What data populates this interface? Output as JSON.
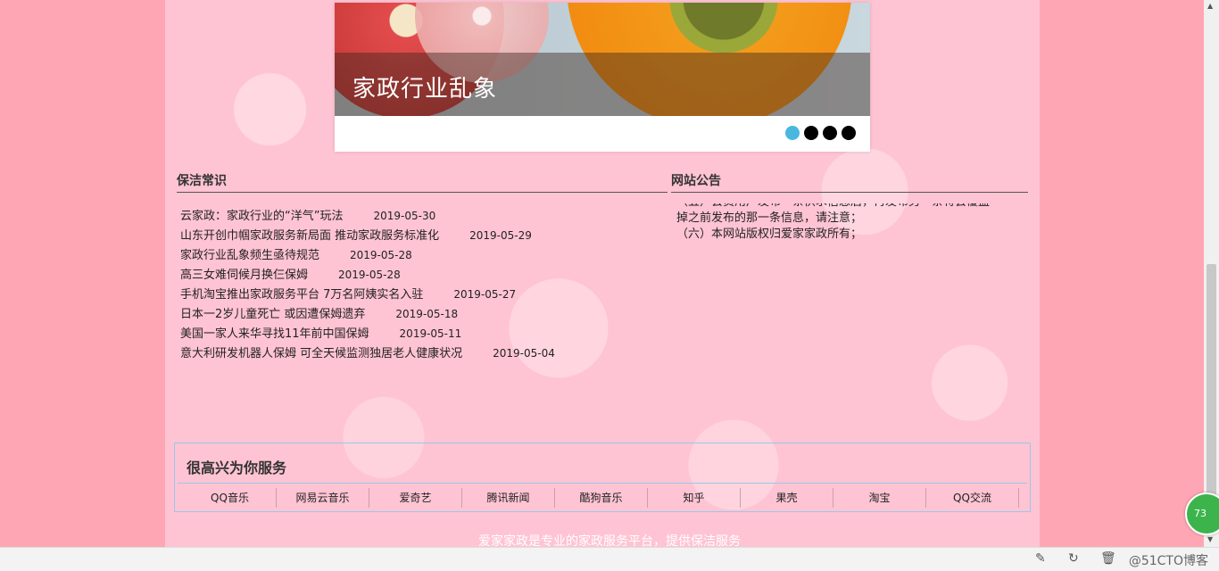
{
  "slider": {
    "caption": "家政行业乱象",
    "dot_count": 4,
    "active_index": 0
  },
  "knowledge": {
    "heading": "保洁常识",
    "items": [
      {
        "title": "云家政：家政行业的“洋气”玩法",
        "date": "2019-05-30"
      },
      {
        "title": "山东开创巾帼家政服务新局面 推动家政服务标准化",
        "date": "2019-05-29"
      },
      {
        "title": "家政行业乱象频生亟待规范",
        "date": "2019-05-28"
      },
      {
        "title": "高三女难伺候月换仨保姆",
        "date": "2019-05-28"
      },
      {
        "title": "手机淘宝推出家政服务平台 7万名阿姨实名入驻",
        "date": "2019-05-27"
      },
      {
        "title": "日本一2岁儿童死亡 或因遭保姆遗弃",
        "date": "2019-05-18"
      },
      {
        "title": "美国一家人来华寻找11年前中国保姆",
        "date": "2019-05-11"
      },
      {
        "title": "意大利研发机器人保姆 可全天候监测独居老人健康状况",
        "date": "2019-05-04"
      }
    ]
  },
  "notice": {
    "heading": "网站公告",
    "lines": [
      "（五）会员用户发布一条供求信息后，再发布另一条将会覆盖",
      "掉之前发布的那一条信息，请注意；",
      "（六）本网站版权归爱家家政所有；"
    ]
  },
  "service": {
    "title": "很高兴为你服务",
    "links": [
      "QQ音乐",
      "网易云音乐",
      "爱奇艺",
      "腾讯新闻",
      "酷狗音乐",
      "知乎",
      "果壳",
      "淘宝",
      "QQ交流"
    ]
  },
  "footer": {
    "text": "爱家家政是专业的家政服务平台，提供保洁服务"
  },
  "bottom_bar": {
    "watermark": "@51CTO博客",
    "badge": "73"
  },
  "colors": {
    "page_bg": "#ffa6b4",
    "content_bg": "#ffc4d3",
    "active_dot": "#4ab7de",
    "service_border": "#9cc6e8"
  }
}
